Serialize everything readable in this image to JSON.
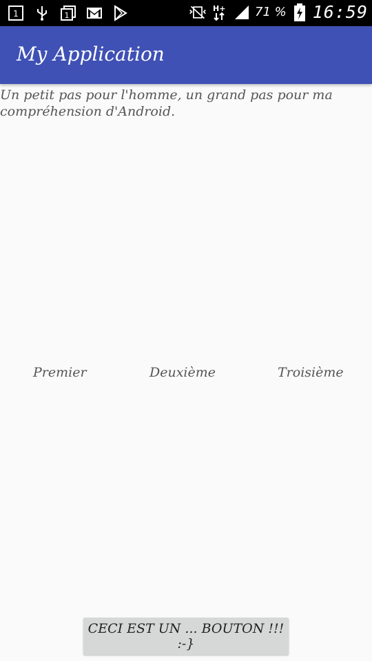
{
  "status_bar": {
    "left_icons": [
      "notification-1-icon",
      "usb-icon",
      "notification-1-icon",
      "gmail-icon",
      "play-store-icon"
    ],
    "right_icons": [
      "vibrate-icon",
      "network-hplus-icon",
      "signal-icon",
      "battery-charging-icon"
    ],
    "network_label": "H+",
    "battery_label": "71 %",
    "time": "16:59"
  },
  "app_bar": {
    "title": "My Application",
    "color": "#3f51b5"
  },
  "content": {
    "intro_text": "Un petit pas pour l'homme, un grand pas pour ma compréhension d'Android.",
    "choices": [
      "Premier",
      "Deuxième",
      "Troisième"
    ],
    "button_label": "CECI EST UN ... BOUTON !!! :-}"
  }
}
